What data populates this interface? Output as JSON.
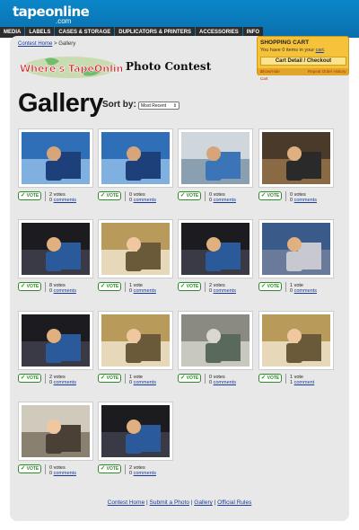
{
  "header": {
    "logo": "tapeonline",
    "logo_sub": ".com",
    "nav": [
      "MEDIA",
      "LABELS",
      "CASES & STORAGE",
      "DUPLICATORS & PRINTERS",
      "ACCESSORIES",
      "INFO"
    ]
  },
  "cart": {
    "title": "SHOPPING CART",
    "text_before": "You have 0 items in your ",
    "link": "cart",
    "text_after": ".",
    "button": "Cart Detail / Checkout",
    "show_hide": "Show/Hide Cart",
    "repeat": "Repeat Order History"
  },
  "breadcrumb": {
    "home": "Contest Home",
    "sep": " > ",
    "current": "Gallery"
  },
  "banner": {
    "logo_text": "Where's TapeOnline!?",
    "title": "Photo Contest"
  },
  "page_title": "Gallery",
  "sort": {
    "label": "Sort by:",
    "value": "Most Recent"
  },
  "vote_label": "VOTE",
  "items": [
    {
      "votes": "2 votes",
      "comments_num": "0",
      "comments_label": "comments",
      "scene": "ocean"
    },
    {
      "votes": "0 votes",
      "comments_num": "0",
      "comments_label": "comments",
      "scene": "ocean"
    },
    {
      "votes": "0 votes",
      "comments_num": "0",
      "comments_label": "comments",
      "scene": "boat"
    },
    {
      "votes": "0 votes",
      "comments_num": "0",
      "comments_label": "comments",
      "scene": "studio"
    },
    {
      "votes": "8 votes",
      "comments_num": "0",
      "comments_label": "comments",
      "scene": "dark"
    },
    {
      "votes": "1 vote",
      "comments_num": "0",
      "comments_label": "comments",
      "scene": "room"
    },
    {
      "votes": "2 votes",
      "comments_num": "0",
      "comments_label": "comments",
      "scene": "dark"
    },
    {
      "votes": "1 vote",
      "comments_num": "0",
      "comments_label": "comments",
      "scene": "blur"
    },
    {
      "votes": "2 votes",
      "comments_num": "0",
      "comments_label": "comments",
      "scene": "dark"
    },
    {
      "votes": "1 vote",
      "comments_num": "0",
      "comments_label": "comments",
      "scene": "room"
    },
    {
      "votes": "0 votes",
      "comments_num": "0",
      "comments_label": "comments",
      "scene": "grey"
    },
    {
      "votes": "1 vote",
      "comments_num": "1",
      "comments_label": "comment",
      "scene": "room"
    },
    {
      "votes": "0 votes",
      "comments_num": "0",
      "comments_label": "comments",
      "scene": "office"
    },
    {
      "votes": "2 votes",
      "comments_num": "0",
      "comments_label": "comments",
      "scene": "dark"
    }
  ],
  "footer": {
    "links": [
      "Contest Home",
      "Submit a Photo",
      "Gallery",
      "Official Rules"
    ],
    "sep": " | "
  }
}
